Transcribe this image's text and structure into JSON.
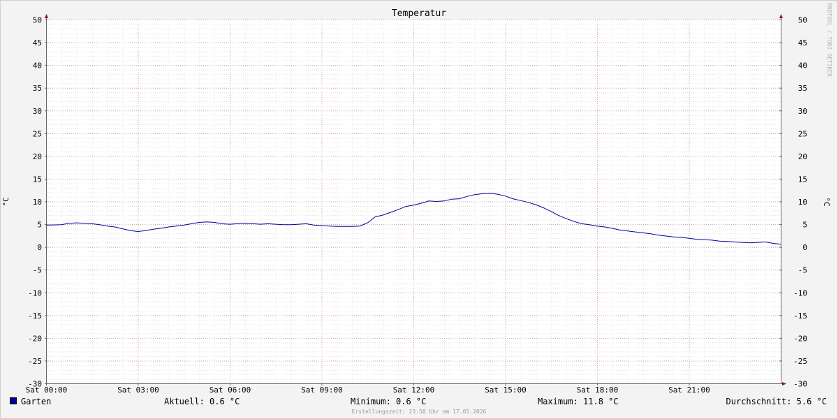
{
  "chart_data": {
    "type": "line",
    "title": "Temperatur",
    "ylabel": "°C",
    "ylim": [
      -30,
      50
    ],
    "y_ticks": [
      50,
      45,
      40,
      35,
      30,
      25,
      20,
      15,
      10,
      5,
      0,
      -5,
      -10,
      -15,
      -20,
      -25,
      -30
    ],
    "x_ticks": [
      "Sat 00:00",
      "Sat 03:00",
      "Sat 06:00",
      "Sat 09:00",
      "Sat 12:00",
      "Sat 15:00",
      "Sat 18:00",
      "Sat 21:00"
    ],
    "xlim_hours": [
      0,
      24
    ],
    "grid": true,
    "series": [
      {
        "name": "Garten",
        "color": "#000099",
        "x_hours": [
          0,
          0.5,
          0.75,
          1.0,
          1.25,
          1.5,
          1.75,
          2.0,
          2.25,
          2.5,
          2.75,
          3.0,
          3.25,
          3.5,
          3.75,
          4.0,
          4.25,
          4.5,
          4.75,
          5.0,
          5.25,
          5.5,
          5.75,
          6.0,
          6.25,
          6.5,
          6.75,
          7.0,
          7.25,
          7.5,
          7.75,
          8.0,
          8.25,
          8.5,
          8.75,
          9.0,
          9.25,
          9.5,
          9.75,
          10.0,
          10.25,
          10.5,
          10.75,
          11.0,
          11.25,
          11.5,
          11.75,
          12.0,
          12.25,
          12.5,
          12.75,
          13.0,
          13.25,
          13.5,
          13.75,
          14.0,
          14.25,
          14.5,
          14.75,
          15.0,
          15.25,
          15.5,
          15.75,
          16.0,
          16.25,
          16.5,
          16.75,
          17.0,
          17.25,
          17.5,
          17.75,
          18.0,
          18.25,
          18.5,
          18.75,
          19.0,
          19.25,
          19.5,
          19.75,
          20.0,
          20.25,
          20.5,
          20.75,
          21.0,
          21.25,
          21.5,
          21.75,
          22.0,
          22.25,
          22.5,
          22.75,
          23.0,
          23.25,
          23.5,
          23.75,
          24.0
        ],
        "values": [
          4.8,
          4.9,
          5.2,
          5.3,
          5.2,
          5.1,
          4.9,
          4.6,
          4.4,
          4.0,
          3.6,
          3.4,
          3.6,
          3.9,
          4.1,
          4.4,
          4.6,
          4.8,
          5.1,
          5.4,
          5.5,
          5.4,
          5.1,
          5.0,
          5.1,
          5.2,
          5.1,
          5.0,
          5.1,
          5.0,
          4.9,
          4.9,
          5.0,
          5.1,
          4.8,
          4.7,
          4.6,
          4.5,
          4.5,
          4.5,
          4.6,
          5.3,
          6.6,
          7.0,
          7.6,
          8.2,
          8.9,
          9.2,
          9.6,
          10.1,
          10.0,
          10.1,
          10.5,
          10.6,
          11.1,
          11.5,
          11.7,
          11.8,
          11.6,
          11.2,
          10.6,
          10.2,
          9.8,
          9.3,
          8.6,
          7.8,
          6.9,
          6.2,
          5.6,
          5.1,
          4.9,
          4.6,
          4.4,
          4.1,
          3.7,
          3.5,
          3.3,
          3.1,
          2.9,
          2.6,
          2.4,
          2.2,
          2.1,
          1.9,
          1.7,
          1.6,
          1.5,
          1.3,
          1.2,
          1.1,
          1.0,
          0.9,
          1.0,
          1.1,
          0.8,
          0.6
        ]
      }
    ]
  },
  "legend": {
    "series_name": "Garten",
    "swatch_color": "#000099",
    "current": "Aktuell: 0.6 °C",
    "minimum": "Minimum: 0.6 °C",
    "maximum": "Maximum: 11.8 °C",
    "average": "Durchschnitt: 5.6 °C"
  },
  "footer": "Erstellungszeit: 23:58 Uhr am 17.01.2026",
  "watermark": "RRDTOOL / TOBI OETIKER"
}
